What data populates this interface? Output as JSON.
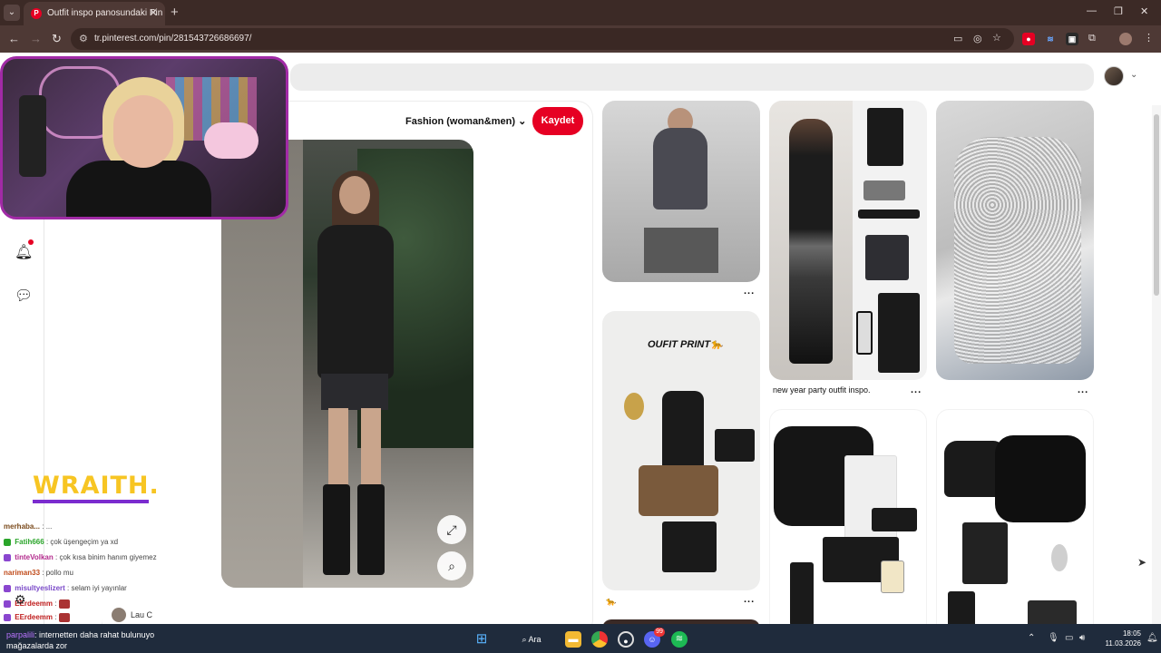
{
  "browser": {
    "tab": {
      "title": "Outfit inspo panosundaki Pin"
    },
    "url": "tr.pinterest.com/pin/281543726686697/"
  },
  "pin": {
    "board": "Fashion (woman&men)",
    "save_label": "Kaydet"
  },
  "feed": {
    "tile2_title": "new year party outfit inspo.",
    "tile4_title": "OUFIT PRINT🐆",
    "tile4_caption": "🐆",
    "more": "..."
  },
  "stream": {
    "overlay_brand": "WRAITH.",
    "chat": [
      {
        "user": "merhaba...",
        "text": ": ...",
        "color": "#7a4a1c"
      },
      {
        "user": "Fatih666",
        "text": ": çok üşengeçim ya xd",
        "color": "#2aa52a"
      },
      {
        "user": "tinteVolkan",
        "text": ": çok kısa binim hanım giyemez",
        "color": "#b32b8d"
      },
      {
        "user": "nariman33",
        "text": ": pollo mu",
        "color": "#c04b1a"
      },
      {
        "user": "misultyeslizert",
        "text": ": selam iyi yayınlar",
        "color": "#7a49c8"
      },
      {
        "user": "EErdeemm",
        "text": ":",
        "color": "#c02020"
      },
      {
        "user": "EErdeemm",
        "text": ":",
        "color": "#c02020"
      }
    ],
    "viewer_name": "Lau C"
  },
  "taskbar": {
    "chat_user": "parpalili",
    "chat_text": ": internetten daha rahat bulunuyo",
    "chat_text2": "mağazalarda zor",
    "search_label": "Ara",
    "discord_badge": "99",
    "time": "18:05",
    "date": "11.03.2026"
  },
  "colors": {
    "accent": "#e60023",
    "frame": "#a12aa6",
    "brand_yellow": "#f7c523"
  },
  "icons": [
    "pinterest-icon",
    "back-icon",
    "forward-icon",
    "reload-icon",
    "bell-icon",
    "chat-icon",
    "expand-icon",
    "lens-icon",
    "gear-icon",
    "windows-icon",
    "chrome-icon",
    "discord-icon",
    "spotify-icon"
  ]
}
